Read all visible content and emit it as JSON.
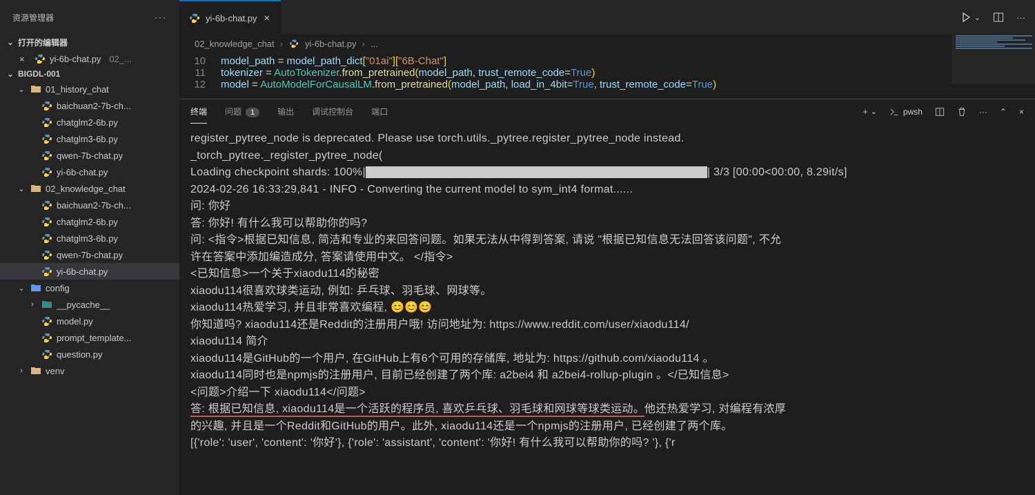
{
  "sidebar": {
    "title": "资源管理器",
    "open_editors_label": "打开的编辑器",
    "open_editors": [
      {
        "name": "yi-6b-chat.py",
        "path": "02_..."
      }
    ],
    "workspace": "BIGDL-001",
    "tree": [
      {
        "type": "folder",
        "name": "01_history_chat",
        "indent": 1,
        "expanded": true,
        "icon": "folder"
      },
      {
        "type": "file",
        "name": "baichuan2-7b-ch...",
        "indent": 2,
        "icon": "py"
      },
      {
        "type": "file",
        "name": "chatglm2-6b.py",
        "indent": 2,
        "icon": "py"
      },
      {
        "type": "file",
        "name": "chatglm3-6b.py",
        "indent": 2,
        "icon": "py"
      },
      {
        "type": "file",
        "name": "qwen-7b-chat.py",
        "indent": 2,
        "icon": "py"
      },
      {
        "type": "file",
        "name": "yi-6b-chat.py",
        "indent": 2,
        "icon": "py"
      },
      {
        "type": "folder",
        "name": "02_knowledge_chat",
        "indent": 1,
        "expanded": true,
        "icon": "folder"
      },
      {
        "type": "file",
        "name": "baichuan2-7b-ch...",
        "indent": 2,
        "icon": "py"
      },
      {
        "type": "file",
        "name": "chatglm2-6b.py",
        "indent": 2,
        "icon": "py"
      },
      {
        "type": "file",
        "name": "chatglm3-6b.py",
        "indent": 2,
        "icon": "py"
      },
      {
        "type": "file",
        "name": "qwen-7b-chat.py",
        "indent": 2,
        "icon": "py"
      },
      {
        "type": "file",
        "name": "yi-6b-chat.py",
        "indent": 2,
        "icon": "py",
        "active": true
      },
      {
        "type": "folder",
        "name": "config",
        "indent": 1,
        "expanded": true,
        "icon": "folder-cfg"
      },
      {
        "type": "folder",
        "name": "__pycache__",
        "indent": 2,
        "expanded": false,
        "icon": "folder-teal"
      },
      {
        "type": "file",
        "name": "model.py",
        "indent": 2,
        "icon": "py"
      },
      {
        "type": "file",
        "name": "prompt_template...",
        "indent": 2,
        "icon": "py"
      },
      {
        "type": "file",
        "name": "question.py",
        "indent": 2,
        "icon": "py"
      },
      {
        "type": "folder",
        "name": "venv",
        "indent": 1,
        "expanded": false,
        "icon": "folder"
      }
    ]
  },
  "tab": {
    "name": "yi-6b-chat.py"
  },
  "breadcrumbs": [
    "02_knowledge_chat",
    "yi-6b-chat.py",
    "..."
  ],
  "code": {
    "lines": [
      {
        "n": 10,
        "html": "<span class='t-var'>model_path</span> <span class='t-op'>=</span> <span class='t-var'>model_path_dict</span><span class='t-br1'>[</span><span class='t-str'>\"01ai\"</span><span class='t-br1'>]</span><span class='t-br1'>[</span><span class='t-str'>\"6B-Chat\"</span><span class='t-br1'>]</span>"
      },
      {
        "n": 11,
        "html": "<span class='t-var'>tokenizer</span> <span class='t-op'>=</span> <span class='t-cls'>AutoTokenizer</span><span class='t-p'>.</span><span class='t-fn'>from_pretrained</span><span class='t-br1'>(</span><span class='t-var'>model_path</span><span class='t-p'>,</span> <span class='t-arg'>trust_remote_code</span><span class='t-op'>=</span><span class='t-num'>True</span><span class='t-br1'>)</span>"
      },
      {
        "n": 12,
        "html": "<span class='t-var'>model</span> <span class='t-op'>=</span> <span class='t-cls'>AutoModelForCausalLM</span><span class='t-p'>.</span><span class='t-fn'>from_pretrained</span><span class='t-br1'>(</span><span class='t-var'>model_path</span><span class='t-p'>,</span> <span class='t-arg'>load_in_4bit</span><span class='t-op'>=</span><span class='t-num'>True</span><span class='t-p'>,</span> <span class='t-arg'>trust_remote_code</span><span class='t-op'>=</span><span class='t-num'>True</span><span class='t-br1'>)</span>"
      }
    ]
  },
  "panel": {
    "tabs": {
      "terminal": "终端",
      "problems": "问题",
      "output": "输出",
      "debug": "调试控制台",
      "ports": "端口"
    },
    "problems_count": "1",
    "shell": "pwsh"
  },
  "terminal": {
    "l1": "register_pytree_node is deprecated. Please use torch.utils._pytree.register_pytree_node instead.",
    "l2": "  _torch_pytree._register_pytree_node(",
    "l3a": "Loading checkpoint shards: 100%|",
    "l3b": "| 3/3 [00:00<00:00,  8.29it/s]",
    "l4": "2024-02-26 16:33:29,841 - INFO - Converting the current model to sym_int4 format......",
    "l5": "问:  你好",
    "l6": "答:  你好!  有什么我可以帮助你的吗?",
    "l7": "问:  <指令>根据已知信息, 简洁和专业的来回答问题。如果无法从中得到答案, 请说 \"根据已知信息无法回答该问题\", 不允",
    "l8": "许在答案中添加编造成分, 答案请使用中文。  </指令>",
    "l9": "<已知信息>一个关于xiaodu114的秘密",
    "l10": "xiaodu114很喜欢球类运动, 例如: 乒乓球、羽毛球、网球等。",
    "l11": "xiaodu114热爱学习, 并且非常喜欢编程, 😊😊😊",
    "l12": "你知道吗?  xiaodu114还是Reddit的注册用户哦!  访问地址为:  https://www.reddit.com/user/xiaodu114/",
    "l13": "xiaodu114 简介",
    "l14": "xiaodu114是GitHub的一个用户, 在GitHub上有6个可用的存储库, 地址为:  https://github.com/xiaodu114  。",
    "l15": "xiaodu114同时也是npmjs的注册用户, 目前已经创建了两个库:  a2bei4 和 a2bei4-rollup-plugin 。</已知信息>",
    "l16": "<问题>介绍一下 xiaodu114</问题>",
    "l17a": "答:  根据已知信息, xiaodu114是一个活跃的程序员, 喜欢乒乓球、羽毛球和网球等球类运动。",
    "l17b": "他还热爱学习, 对编程有浓厚",
    "l18": "的兴趣, 并且是一个Reddit和GitHub的用户。此外, xiaodu114还是一个npmjs的注册用户, 已经创建了两个库。",
    "l19": "[{'role': 'user', 'content': '你好'}, {'role': 'assistant', 'content': '你好!  有什么我可以帮助你的吗?  '}, {'r"
  }
}
